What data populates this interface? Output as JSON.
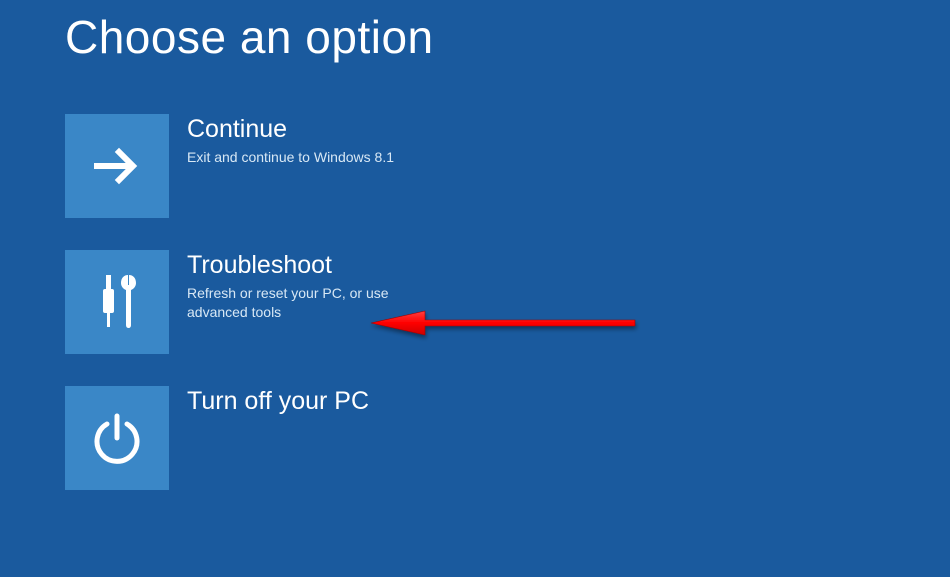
{
  "page": {
    "title": "Choose an option"
  },
  "options": [
    {
      "icon": "arrow-right",
      "title": "Continue",
      "description": "Exit and continue to Windows 8.1"
    },
    {
      "icon": "tools",
      "title": "Troubleshoot",
      "description": "Refresh or reset your PC, or use advanced tools"
    },
    {
      "icon": "power",
      "title": "Turn off your PC",
      "description": ""
    }
  ],
  "colors": {
    "background": "#1a5a9e",
    "tileBackground": "#3a87c7",
    "text": "#ffffff",
    "descriptionText": "#d8e8f5",
    "annotationArrow": "#ff0000"
  }
}
